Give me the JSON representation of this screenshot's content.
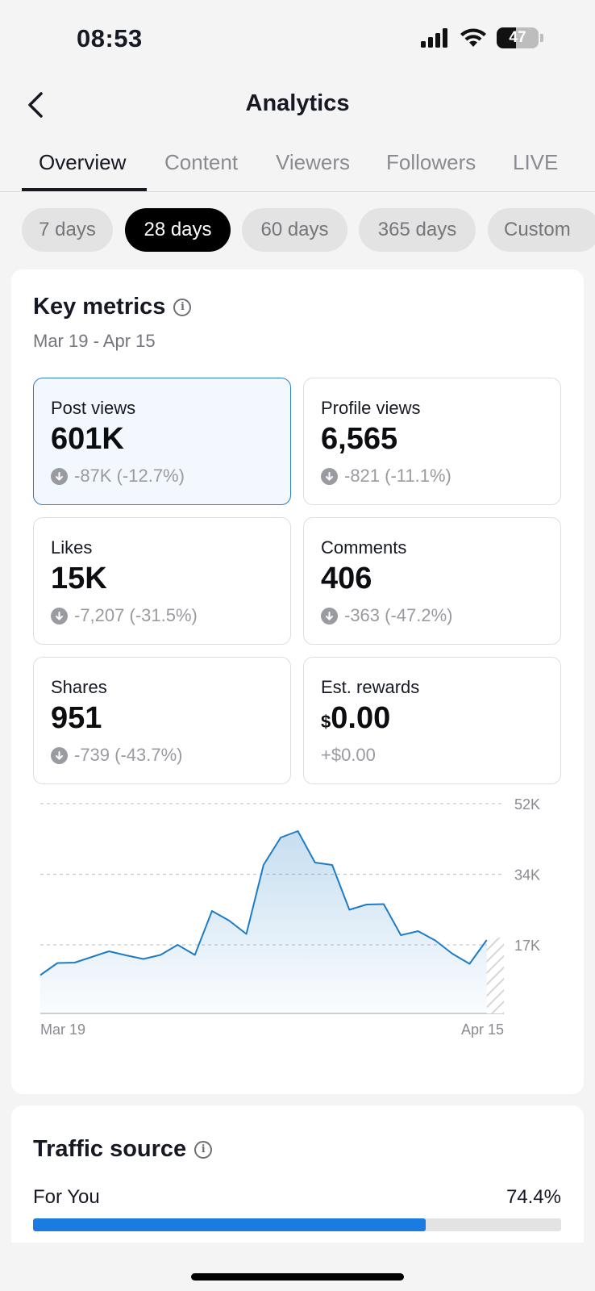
{
  "status_bar": {
    "time": "08:53",
    "battery": "47"
  },
  "header": {
    "title": "Analytics"
  },
  "tabs": [
    {
      "label": "Overview",
      "active": true
    },
    {
      "label": "Content",
      "active": false
    },
    {
      "label": "Viewers",
      "active": false
    },
    {
      "label": "Followers",
      "active": false
    },
    {
      "label": "LIVE",
      "active": false
    }
  ],
  "date_ranges": [
    {
      "label": "7 days",
      "active": false
    },
    {
      "label": "28 days",
      "active": true
    },
    {
      "label": "60 days",
      "active": false
    },
    {
      "label": "365 days",
      "active": false
    },
    {
      "label": "Custom",
      "active": false
    }
  ],
  "key_metrics": {
    "title": "Key metrics",
    "date_range": "Mar 19 - Apr 15",
    "items": [
      {
        "label": "Post views",
        "value": "601K",
        "delta": "-87K (-12.7%)",
        "selected": true
      },
      {
        "label": "Profile views",
        "value": "6,565",
        "delta": "-821 (-11.1%)"
      },
      {
        "label": "Likes",
        "value": "15K",
        "delta": "-7,207 (-31.5%)"
      },
      {
        "label": "Comments",
        "value": "406",
        "delta": "-363 (-47.2%)"
      },
      {
        "label": "Shares",
        "value": "951",
        "delta": "-739 (-43.7%)"
      },
      {
        "label": "Est. rewards",
        "currency": "$",
        "value": "0.00",
        "delta": "+$0.00"
      }
    ]
  },
  "chart_data": {
    "type": "area",
    "x": [
      "Mar 19",
      "Mar 20",
      "Mar 21",
      "Mar 22",
      "Mar 23",
      "Mar 24",
      "Mar 25",
      "Mar 26",
      "Mar 27",
      "Mar 28",
      "Mar 29",
      "Mar 30",
      "Mar 31",
      "Apr 1",
      "Apr 2",
      "Apr 3",
      "Apr 4",
      "Apr 5",
      "Apr 6",
      "Apr 7",
      "Apr 8",
      "Apr 9",
      "Apr 10",
      "Apr 11",
      "Apr 12",
      "Apr 13",
      "Apr 14",
      "Apr 15"
    ],
    "series": [
      {
        "values": [
          9500,
          12500,
          12600,
          14000,
          15400,
          14400,
          13500,
          14500,
          17000,
          14500,
          25400,
          23000,
          19700,
          36800,
          43600,
          45200,
          37400,
          36800,
          25700,
          27000,
          27100,
          19400,
          20400,
          18100,
          14800,
          12300,
          18200,
          9000
        ]
      }
    ],
    "x_tick_labels": [
      "Mar 19",
      "Apr 15"
    ],
    "y_tick_labels": [
      "17K",
      "34K",
      "52K"
    ],
    "y_ticks": [
      17000,
      34500,
      52000
    ],
    "ylim": [
      0,
      52000
    ],
    "partial_last_day": true,
    "color": "#1e7cc6"
  },
  "traffic_source": {
    "title": "Traffic source",
    "items": [
      {
        "label": "For You",
        "value": "74.4%",
        "percent": 74.4
      }
    ]
  }
}
